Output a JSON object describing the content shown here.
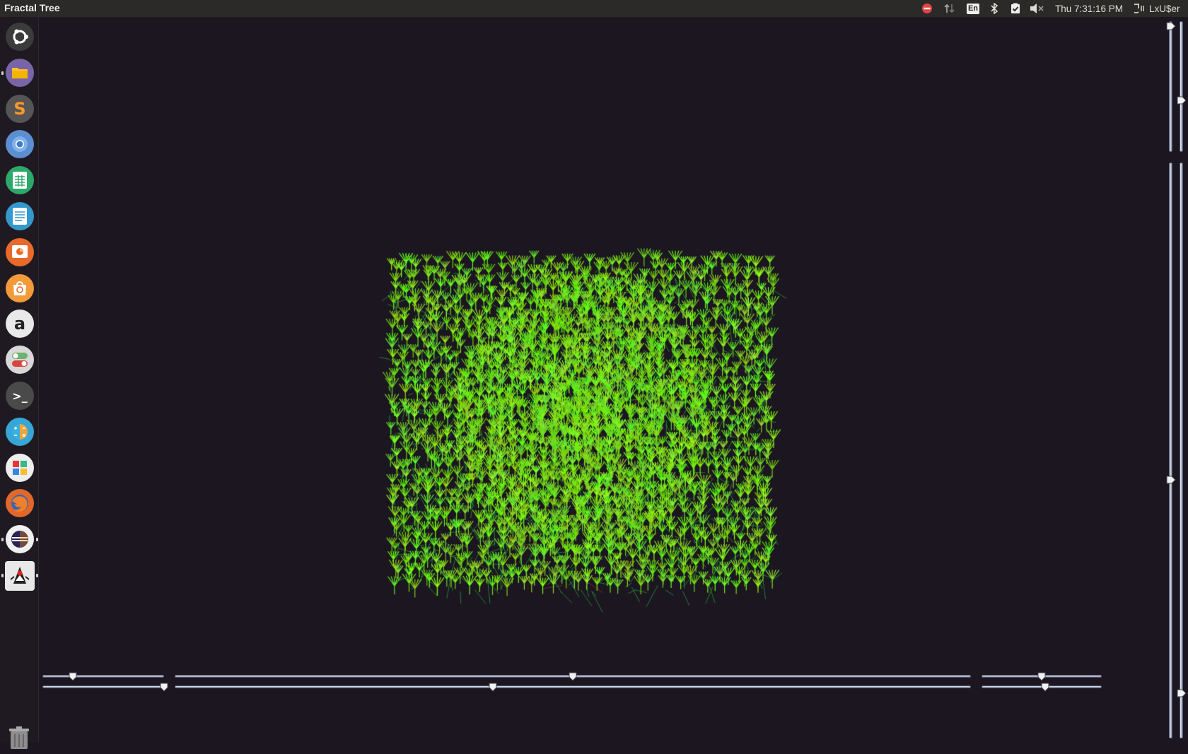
{
  "window": {
    "title": "Fractal Tree"
  },
  "panel": {
    "language": "En",
    "clock": "Thu 7:31:16 PM",
    "user": "LxU$er",
    "indicators": [
      "stop-sign-icon",
      "network-transfer-icon",
      "keyboard-language-indicator",
      "bluetooth-icon",
      "task-checked-icon",
      "volume-muted-icon",
      "session-power-icon"
    ]
  },
  "launcher": {
    "items": [
      {
        "name": "dash-home",
        "icon": "ubuntu-logo-icon",
        "color": "#3b3b3b"
      },
      {
        "name": "files",
        "icon": "folder-icon",
        "color": "#7a64a8",
        "running": true
      },
      {
        "name": "sublime-text",
        "icon": "sublime-s-icon",
        "label": "S",
        "color": "#555555"
      },
      {
        "name": "chromium",
        "icon": "chromium-icon",
        "color": "#5b8fd1"
      },
      {
        "name": "libreoffice-calc",
        "icon": "spreadsheet-icon",
        "color": "#2ea86a"
      },
      {
        "name": "libreoffice-writer",
        "icon": "document-icon",
        "color": "#3399cc"
      },
      {
        "name": "libreoffice-impress",
        "icon": "presentation-icon",
        "color": "#e86a2a"
      },
      {
        "name": "software-center",
        "icon": "shopping-bag-icon",
        "color": "#f39a3a"
      },
      {
        "name": "amazon",
        "icon": "amazon-a-icon",
        "label": "a",
        "color": "#e9e9e9"
      },
      {
        "name": "system-settings",
        "icon": "toggle-switches-icon",
        "color": "#d8d8d8"
      },
      {
        "name": "terminal",
        "icon": "terminal-prompt-icon",
        "label": ">_",
        "color": "#4a4a4a"
      },
      {
        "name": "calculator",
        "icon": "calculator-icon",
        "color": "#36a6d6"
      },
      {
        "name": "app-grid",
        "icon": "colored-squares-icon",
        "color": "#eeeeee"
      },
      {
        "name": "firefox",
        "icon": "firefox-icon",
        "color": "#e2672b"
      },
      {
        "name": "eclipse",
        "icon": "eclipse-icon",
        "color": "#f0f0f0",
        "running": true
      },
      {
        "name": "java-app",
        "icon": "java-duke-icon",
        "color": "#e8e8e8",
        "running": true
      }
    ],
    "trash": "trash-icon"
  },
  "colors": {
    "background": "#1b1620",
    "leaf": "#7cff1a",
    "wire": "#2bd34a",
    "trunk": "#b84d1e"
  },
  "controls": {
    "sliders_h": [
      {
        "name": "slider-bottom-1",
        "value": 0.25
      },
      {
        "name": "slider-bottom-2",
        "value": 1.0
      },
      {
        "name": "slider-bottom-3",
        "value": 0.5
      },
      {
        "name": "slider-bottom-4",
        "value": 0.4
      },
      {
        "name": "slider-bottom-5",
        "value": 0.5
      },
      {
        "name": "slider-bottom-6",
        "value": 0.53
      }
    ],
    "sliders_v": [
      {
        "name": "slider-right-1",
        "value": 0.0
      },
      {
        "name": "slider-right-2",
        "value": 0.6
      },
      {
        "name": "slider-right-3",
        "value": 0.55
      },
      {
        "name": "slider-right-4",
        "value": 0.92
      }
    ]
  }
}
